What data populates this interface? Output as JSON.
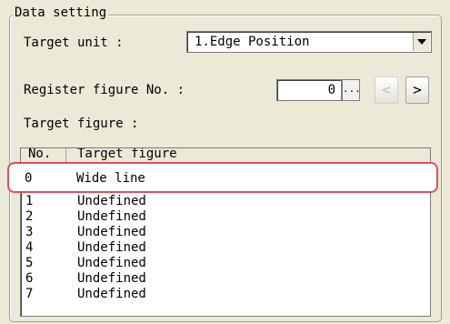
{
  "group": {
    "title": "Data setting"
  },
  "target_unit": {
    "label": "Target unit :",
    "value": "1.Edge Position"
  },
  "register": {
    "label": "Register figure No. :",
    "value": "0",
    "dots": "...",
    "prev": "<",
    "next": ">"
  },
  "target_figure": {
    "label": "Target figure :",
    "columns": [
      "No.",
      "Target figure"
    ],
    "rows": [
      {
        "no": "0",
        "figure": "Wide line"
      },
      {
        "no": "1",
        "figure": "Undefined"
      },
      {
        "no": "2",
        "figure": "Undefined"
      },
      {
        "no": "3",
        "figure": "Undefined"
      },
      {
        "no": "4",
        "figure": "Undefined"
      },
      {
        "no": "5",
        "figure": "Undefined"
      },
      {
        "no": "6",
        "figure": "Undefined"
      },
      {
        "no": "7",
        "figure": "Undefined"
      }
    ],
    "selected_index": 0
  },
  "colors": {
    "highlight": "#e0505a",
    "panel": "#ece9d8"
  }
}
